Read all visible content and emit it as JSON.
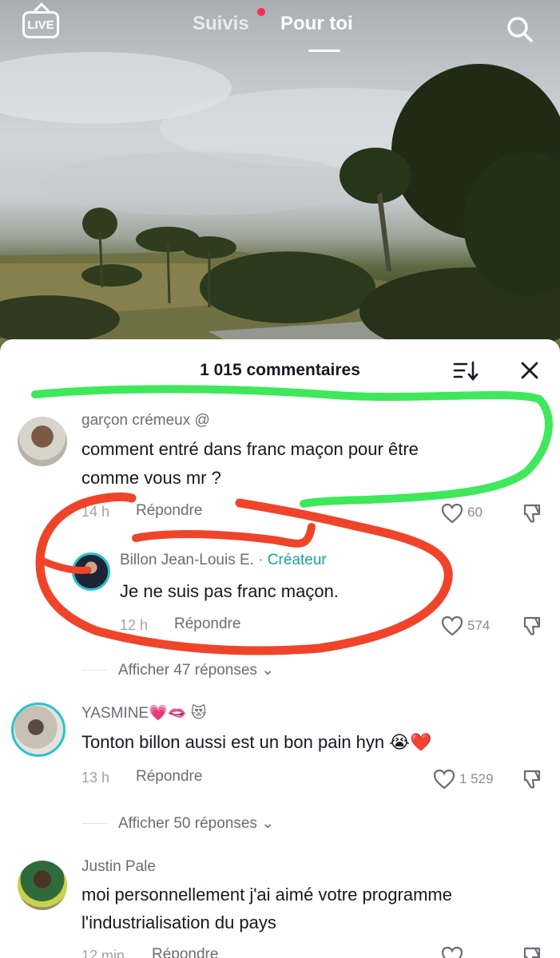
{
  "topbar": {
    "live_label": "LIVE",
    "tab_following": "Suivis",
    "tab_for_you": "Pour toi"
  },
  "comments_sheet": {
    "title": "1 015 commentaires",
    "comments": [
      {
        "username": "garçon crémeux @",
        "text_line1": "comment entré dans franc maçon pour être",
        "text_line2": "comme vous mr ?",
        "time": "14 h",
        "reply_label": "Répondre",
        "likes": "60"
      },
      {
        "username": "Billon Jean-Louis  E. · ",
        "creator_label": "Créateur",
        "text": "Je ne suis pas franc maçon.",
        "time": "12 h",
        "reply_label": "Répondre",
        "likes": "574",
        "view_replies": "Afficher 47 réponses"
      },
      {
        "username": "YASMINE💗🫦 😻",
        "text": "Tonton billon aussi est un bon pain hyn 😭❤️",
        "time": "13 h",
        "reply_label": "Répondre",
        "likes": "1 529",
        "view_replies": "Afficher 50 réponses"
      },
      {
        "username": "Justin Pale",
        "text_line1": "moi personnellement j'ai aimé votre programme",
        "text_line2": "l'industrialisation du pays",
        "time": "12 min",
        "reply_label": "Répondre"
      }
    ]
  },
  "colors": {
    "live_dot": "#fe2c55",
    "creator_tag": "#18a0a8",
    "green_markup": "#3fe85a",
    "red_markup": "#f0442a"
  },
  "icons": [
    "live-icon",
    "search-icon",
    "sort-icon",
    "close-icon",
    "heart-icon",
    "dislike-icon",
    "chevron-down-icon"
  ]
}
